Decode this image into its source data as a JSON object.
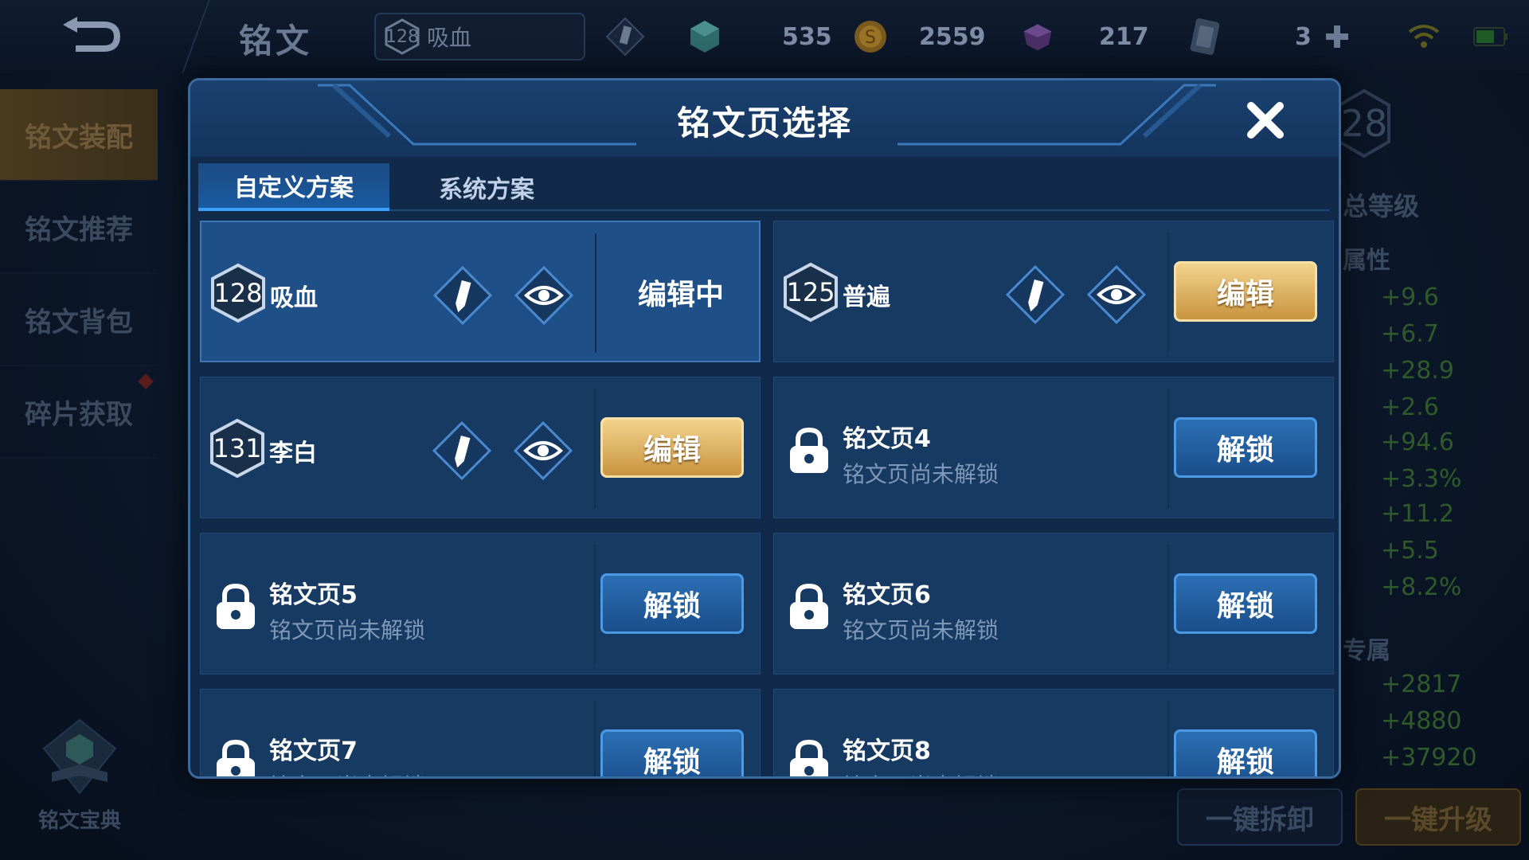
{
  "topbar": {
    "title": "铭文",
    "current_page": {
      "level": "128",
      "name": "吸血"
    },
    "resources": [
      {
        "icon": "crystal-gem-icon",
        "value": "535"
      },
      {
        "icon": "gold-coin-icon",
        "value": "2559"
      },
      {
        "icon": "purple-gem-icon",
        "value": "217"
      },
      {
        "icon": "card-voucher-icon",
        "value": "3"
      }
    ]
  },
  "sidebar": {
    "items": [
      {
        "label": "铭文装配",
        "active": true
      },
      {
        "label": "铭文推荐",
        "active": false
      },
      {
        "label": "铭文背包",
        "active": false
      },
      {
        "label": "碎片获取",
        "active": false
      }
    ],
    "codex_label": "铭文宝典"
  },
  "background_panel": {
    "total_level_value": "28",
    "total_level_label": "总等级",
    "attributes_label": "属性",
    "stats": [
      "+9.6",
      "+6.7",
      "+28.9",
      "+2.6",
      "+94.6",
      "+3.3%",
      "+11.2",
      "+5.5",
      "+8.2%"
    ],
    "exclusive_label": "专属",
    "exclusive_stats": [
      "+2817",
      "+4880",
      "+37920"
    ],
    "disassemble_button": "一键拆卸",
    "upgrade_button": "一键升级"
  },
  "modal": {
    "title": "铭文页选择",
    "tabs": [
      {
        "label": "自定义方案",
        "active": true
      },
      {
        "label": "系统方案",
        "active": false
      }
    ],
    "pages": [
      {
        "locked": false,
        "level": "128",
        "name": "吸血",
        "state": "editing",
        "action_label": "编辑中"
      },
      {
        "locked": false,
        "level": "125",
        "name": "普遍",
        "state": "idle",
        "action_label": "编辑"
      },
      {
        "locked": false,
        "level": "131",
        "name": "李白",
        "state": "idle",
        "action_label": "编辑"
      },
      {
        "locked": true,
        "name": "铭文页4",
        "subtitle": "铭文页尚未解锁",
        "action_label": "解锁"
      },
      {
        "locked": true,
        "name": "铭文页5",
        "subtitle": "铭文页尚未解锁",
        "action_label": "解锁"
      },
      {
        "locked": true,
        "name": "铭文页6",
        "subtitle": "铭文页尚未解锁",
        "action_label": "解锁"
      },
      {
        "locked": true,
        "name": "铭文页7",
        "subtitle": "铭文页尚未解锁",
        "action_label": "解锁"
      },
      {
        "locked": true,
        "name": "铭文页8",
        "subtitle": "铭文页尚未解锁",
        "action_label": "解锁"
      }
    ]
  },
  "colors": {
    "accent_gold": "#d9a94e",
    "accent_blue": "#2b6fb4",
    "modal_bg": "#122a4a"
  }
}
